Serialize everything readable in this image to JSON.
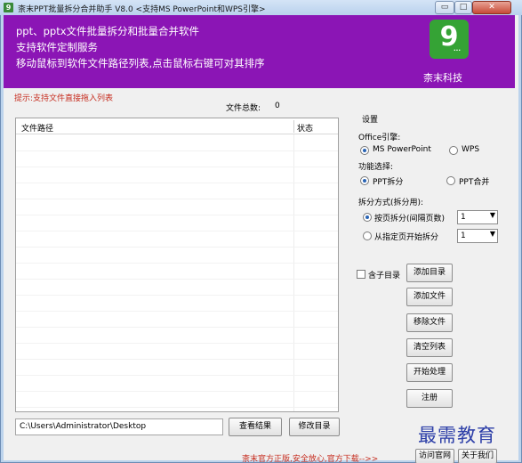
{
  "window": {
    "icon_glyph": "9",
    "title": "柰末PPT批量拆分合并助手 V8.0 <支持MS PowerPoint和WPS引擎>",
    "min_glyph": "▭",
    "max_glyph": "□",
    "close_glyph": "✕"
  },
  "banner": {
    "line1": "ppt、pptx文件批量拆分和批量合并软件",
    "line2": "支持软件定制服务",
    "line3": "移动鼠标到软件文件路径列表,点击鼠标右键可对其排序",
    "logo_glyph": "9",
    "logo_dots": "...",
    "company": "柰末科技",
    "color": "#8b15b5"
  },
  "hint": "提示:支持文件直接拖入列表",
  "file_count": {
    "label": "文件总数:",
    "value": "0"
  },
  "table": {
    "col_path": "文件路径",
    "col_status": "状态"
  },
  "path_input": {
    "value": "C:\\Users\\Administrator\\Desktop"
  },
  "buttons": {
    "view_results": "查看结果",
    "change_dir": "修改目录",
    "add_dir": "添加目录",
    "add_file": "添加文件",
    "remove_file": "移除文件",
    "clear_list": "清空列表",
    "start": "开始处理",
    "register": "注册",
    "visit_site": "访问官网",
    "about": "关于我们"
  },
  "settings": {
    "title": "设置",
    "office_engine_label": "Office引擎:",
    "engine_ms": "MS PowerPoint",
    "engine_wps": "WPS",
    "engine_selected": "MS PowerPoint",
    "function_label": "功能选择:",
    "func_split": "PPT拆分",
    "func_merge": "PPT合并",
    "function_selected": "PPT拆分",
    "split_mode_label": "拆分方式(拆分用):",
    "mode_by_page": "按页拆分(间隔页数)",
    "mode_from_page": "从指定页开始拆分",
    "mode_selected": "按页拆分(间隔页数)",
    "interval_value": "1",
    "start_page_value": "1",
    "dropdown_glyph": "▼"
  },
  "include_subdir": {
    "label": "含子目录",
    "checked": false
  },
  "footer": "柰末官方正版,安全放心,官方下载-->>",
  "watermark": "最需教育",
  "colors": {
    "accent_red": "#c62d1f",
    "radio_blue": "#2a64b4",
    "logo_green": "#35a335"
  }
}
